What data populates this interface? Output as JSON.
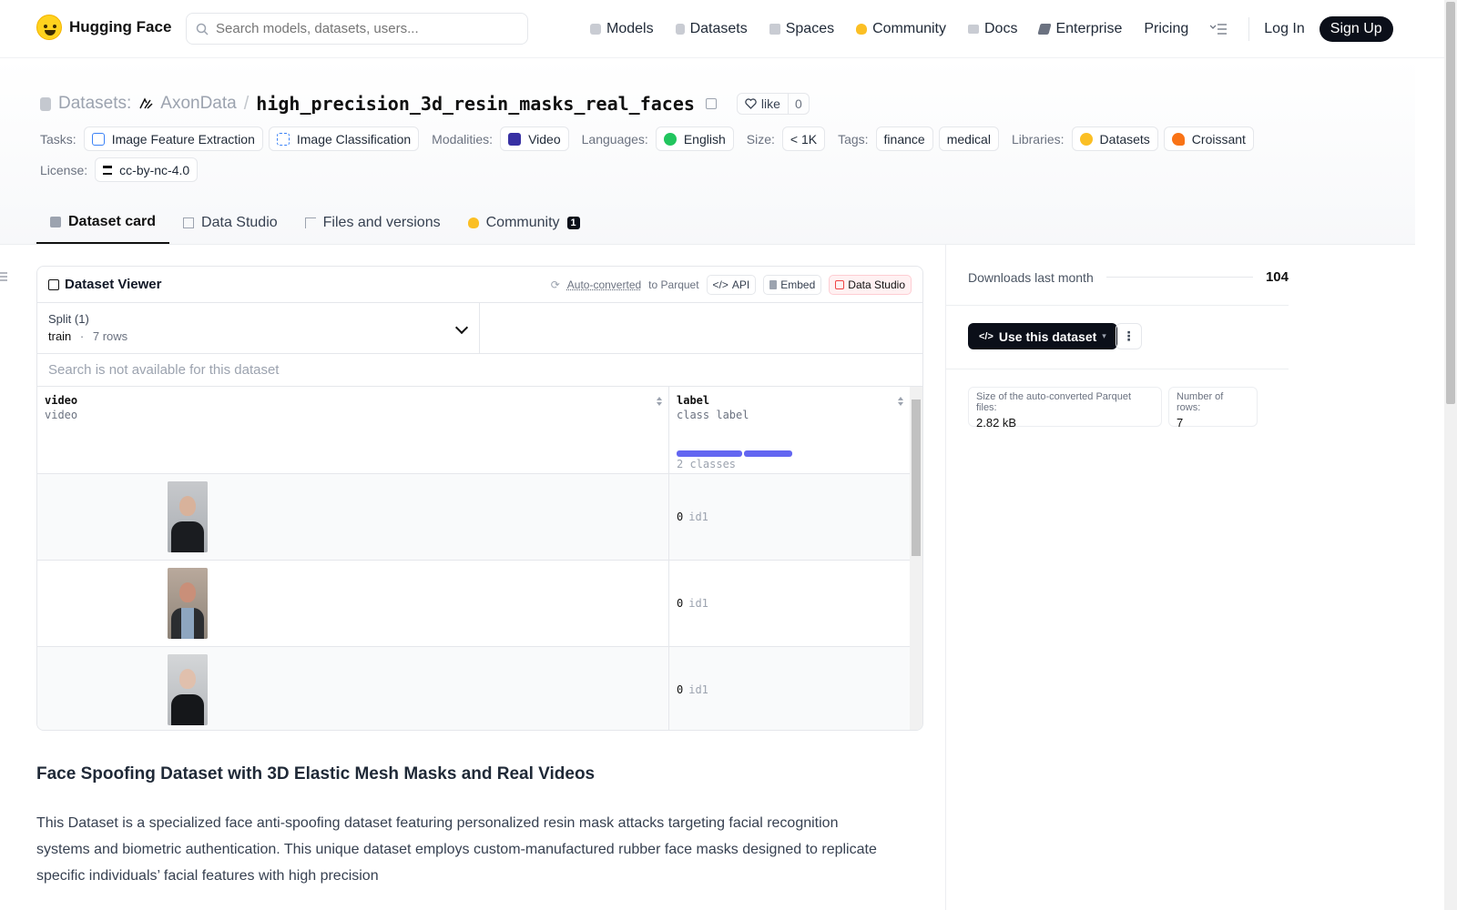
{
  "nav": {
    "brand": "Hugging Face",
    "search_placeholder": "Search models, datasets, users...",
    "links": [
      "Models",
      "Datasets",
      "Spaces",
      "Community",
      "Docs",
      "Enterprise",
      "Pricing"
    ],
    "login": "Log In",
    "signup": "Sign Up"
  },
  "header": {
    "crumb": "Datasets:",
    "org": "AxonData",
    "sep": "/",
    "name": "high_precision_3d_resin_masks_real_faces",
    "like_label": "like",
    "like_count": "0",
    "tasks_label": "Tasks:",
    "tasks": [
      "Image Feature Extraction",
      "Image Classification"
    ],
    "modalities_label": "Modalities:",
    "modalities": [
      "Video"
    ],
    "languages_label": "Languages:",
    "languages": [
      "English"
    ],
    "size_label": "Size:",
    "size": "< 1K",
    "tags_label": "Tags:",
    "tags": [
      "finance",
      "medical"
    ],
    "libraries_label": "Libraries:",
    "libraries": [
      "Datasets",
      "Croissant"
    ],
    "license_label": "License:",
    "license": "cc-by-nc-4.0"
  },
  "tabs": [
    {
      "label": "Dataset card",
      "active": true
    },
    {
      "label": "Data Studio"
    },
    {
      "label": "Files and versions"
    },
    {
      "label": "Community",
      "badge": "1"
    }
  ],
  "viewer": {
    "title": "Dataset Viewer",
    "auto_link": "Auto-converted",
    "auto_to": "to Parquet",
    "api": "API",
    "embed": "Embed",
    "studio": "Data Studio",
    "split_label": "Split (1)",
    "split_value": "train",
    "split_dot": "·",
    "split_rows": "7 rows",
    "search_msg": "Search is not available for this dataset",
    "columns": [
      {
        "name": "video",
        "type": "video"
      },
      {
        "name": "label",
        "type": "class label",
        "classes_text": "2 classes"
      }
    ],
    "rows": [
      {
        "label_num": "0",
        "label_name": "id1"
      },
      {
        "label_num": "0",
        "label_name": "id1"
      },
      {
        "label_num": "0",
        "label_name": "id1"
      }
    ]
  },
  "card": {
    "heading": "Face Spoofing Dataset with 3D Elastic Mesh Masks and Real Videos",
    "paragraph": "This Dataset is a specialized face anti-spoofing dataset featuring personalized resin mask attacks targeting facial recognition systems and biometric authentication. This unique dataset employs custom-manufactured rubber face masks designed to replicate specific individuals’ facial features with high precision"
  },
  "sidebar": {
    "downloads_label": "Downloads last month",
    "downloads": "104",
    "use_button": "Use this dataset",
    "more": "⋮",
    "parquet_label": "Size of the auto-converted Parquet files:",
    "parquet_size": "2.82 kB",
    "rows_label": "Number of rows:",
    "rows": "7"
  },
  "colors": {
    "accent": "#6366f1",
    "dark": "#0b0f19",
    "studio_red": "#ef4444"
  }
}
